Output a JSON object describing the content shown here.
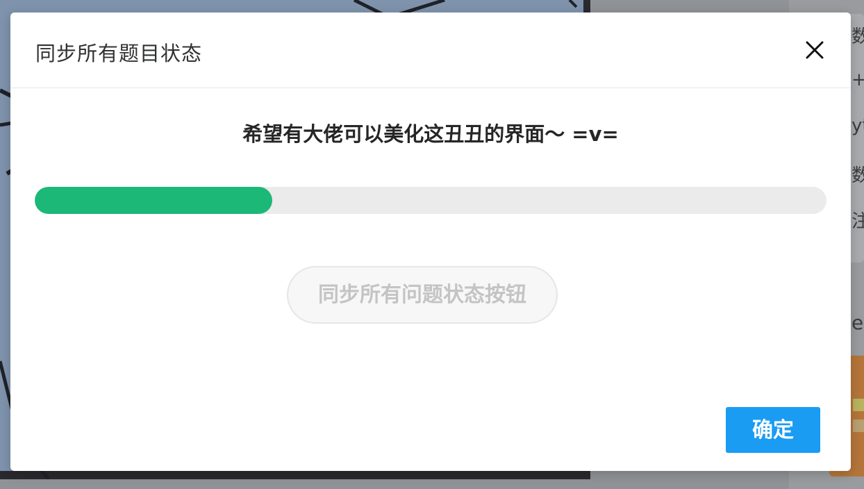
{
  "background": {
    "right_fragments": [
      "数学",
      "+",
      "yt",
      "数据",
      "注",
      "e"
    ]
  },
  "modal": {
    "title": "同步所有题目状态",
    "close_icon": "close-icon",
    "message": "希望有大佬可以美化这丑丑的界面～ =v=",
    "progress": {
      "fraction": 0.3,
      "color": "#1bb877",
      "track_color": "#ebebeb"
    },
    "sync_button_label": "同步所有问题状态按钮",
    "sync_button_disabled": true,
    "confirm_button_label": "确定",
    "accent_color": "#1a9cf3"
  }
}
